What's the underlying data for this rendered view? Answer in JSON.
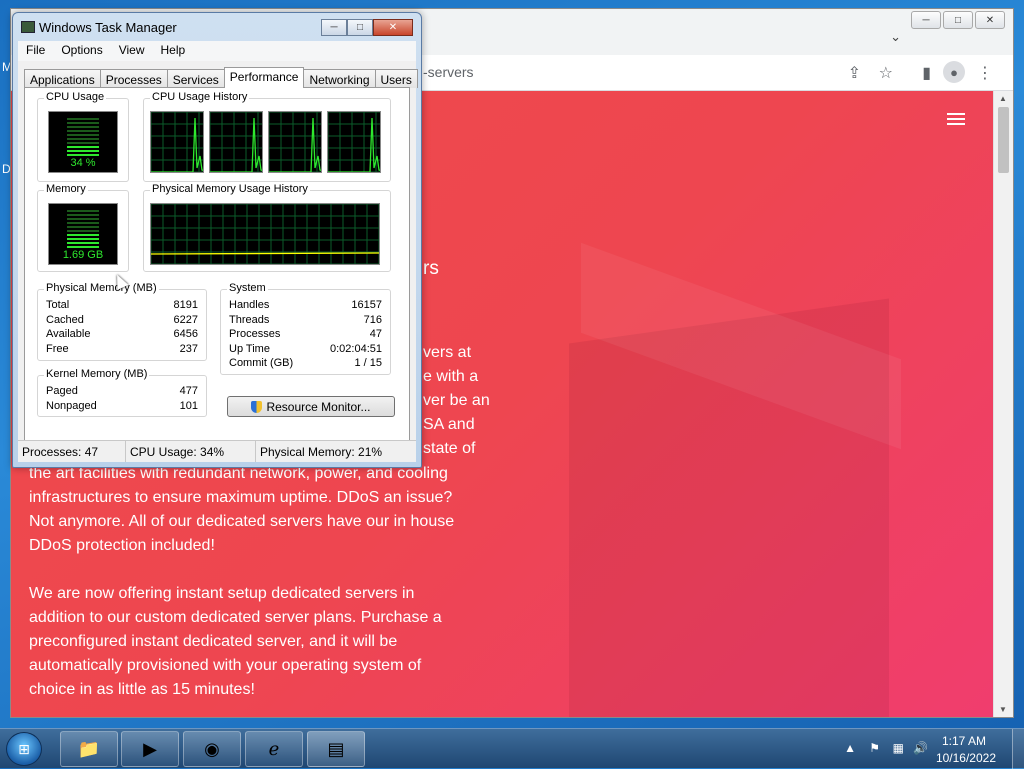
{
  "desktop": {
    "letters": [
      "M",
      "D"
    ]
  },
  "browser": {
    "url_fragment": "-servers",
    "tab_search_glyph": "⌄",
    "controls": {
      "minimize": "─",
      "maximize": "□",
      "close": "✕"
    },
    "toolbar_icons": [
      "share-icon",
      "star-icon",
      "sidepanel-icon",
      "profile-icon",
      "menu-icon"
    ],
    "page": {
      "heading_fragment": "rs",
      "partial_lines": [
        "vers at",
        "e with a",
        "ver be an",
        "SA and",
        "state of"
      ],
      "paragraph1": [
        "the art facilities with redundant network, power, and cooling",
        "infrastructures to ensure maximum uptime. DDoS an issue?",
        "Not anymore. All of our dedicated servers have our in house",
        "DDoS protection included!"
      ],
      "paragraph2": [
        "We are now offering instant setup dedicated servers in",
        "addition to our custom dedicated server plans. Purchase a",
        "preconfigured instant dedicated server, and it will be",
        "automatically provisioned with your operating system of",
        "choice in as little as 15 minutes!"
      ],
      "bg_colors": [
        "#ef4a4a",
        "#f03d6e"
      ]
    }
  },
  "taskmanager": {
    "title": "Windows Task Manager",
    "menu": [
      "File",
      "Options",
      "View",
      "Help"
    ],
    "tabs": [
      "Applications",
      "Processes",
      "Services",
      "Performance",
      "Networking",
      "Users"
    ],
    "active_tab": "Performance",
    "cpu_usage_label": "CPU Usage",
    "cpu_usage_value": "34 %",
    "cpu_usage_fraction": 0.34,
    "cpu_history_label": "CPU Usage History",
    "memory_label": "Memory",
    "memory_value": "1.69 GB",
    "memory_fraction": 0.21,
    "phys_history_label": "Physical Memory Usage History",
    "phys_memory": {
      "label": "Physical Memory (MB)",
      "rows": [
        {
          "name": "Total",
          "value": "8191"
        },
        {
          "name": "Cached",
          "value": "6227"
        },
        {
          "name": "Available",
          "value": "6456"
        },
        {
          "name": "Free",
          "value": "237"
        }
      ]
    },
    "system": {
      "label": "System",
      "rows": [
        {
          "name": "Handles",
          "value": "16157"
        },
        {
          "name": "Threads",
          "value": "716"
        },
        {
          "name": "Processes",
          "value": "47"
        },
        {
          "name": "Up Time",
          "value": "0:02:04:51"
        },
        {
          "name": "Commit (GB)",
          "value": "1 / 15"
        }
      ]
    },
    "kernel_memory": {
      "label": "Kernel Memory (MB)",
      "rows": [
        {
          "name": "Paged",
          "value": "477"
        },
        {
          "name": "Nonpaged",
          "value": "101"
        }
      ]
    },
    "resource_monitor_button": "Resource Monitor...",
    "status": {
      "processes": "Processes: 47",
      "cpu": "CPU Usage: 34%",
      "memory": "Physical Memory: 21%"
    },
    "graph_color": "#2ee82e"
  },
  "taskbar": {
    "pinned": [
      "explorer-icon",
      "media-player-icon",
      "chrome-icon",
      "ie-icon",
      "taskmanager-icon"
    ],
    "clock_time": "1:17 AM",
    "clock_date": "10/16/2022"
  }
}
